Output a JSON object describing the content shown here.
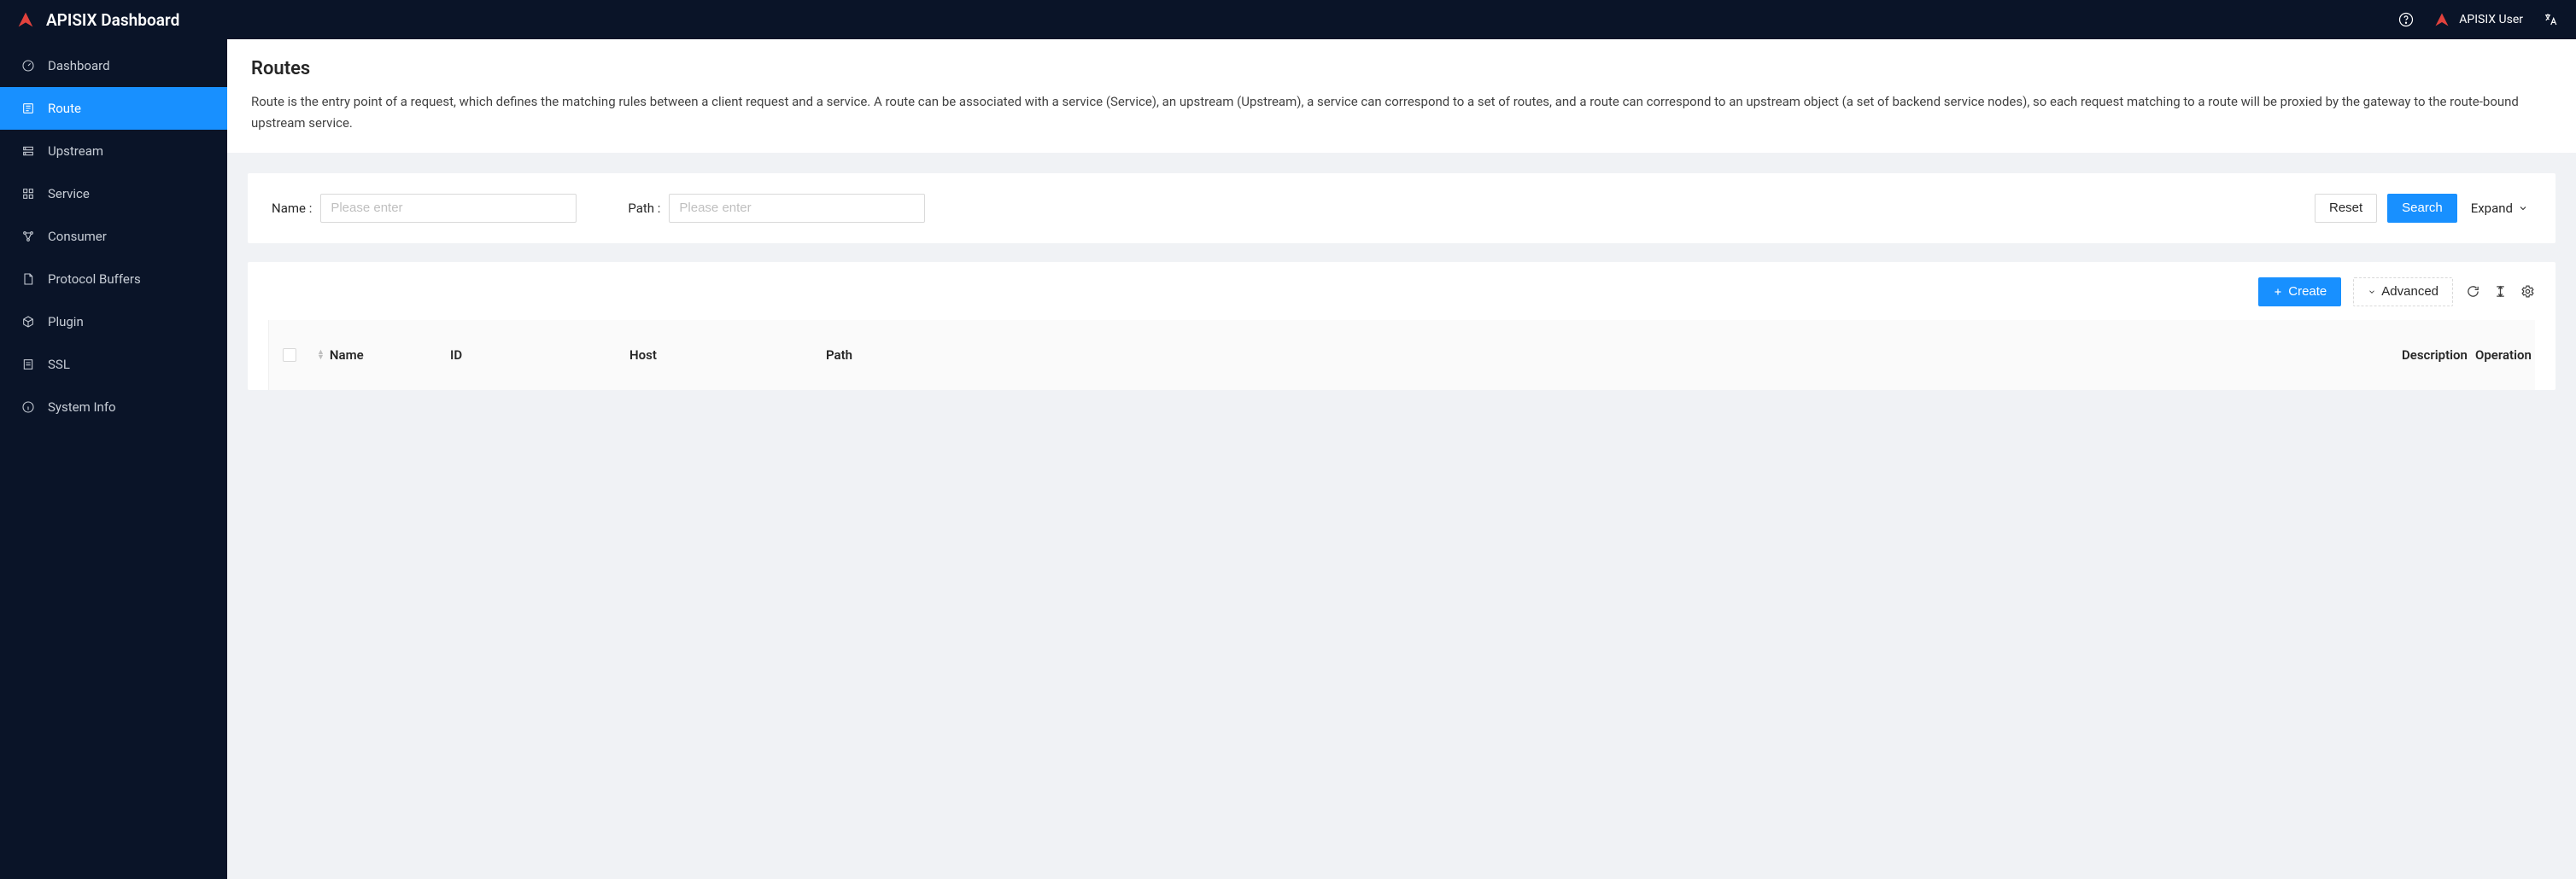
{
  "header": {
    "app_name": "APISIX Dashboard",
    "user_name": "APISIX User"
  },
  "sidebar": {
    "items": [
      {
        "label": "Dashboard",
        "icon": "gauge-icon",
        "key": "dashboard"
      },
      {
        "label": "Route",
        "icon": "route-icon",
        "key": "route"
      },
      {
        "label": "Upstream",
        "icon": "server-icon",
        "key": "upstream"
      },
      {
        "label": "Service",
        "icon": "grid-icon",
        "key": "service"
      },
      {
        "label": "Consumer",
        "icon": "nodes-icon",
        "key": "consumer"
      },
      {
        "label": "Protocol Buffers",
        "icon": "file-icon",
        "key": "protobuf"
      },
      {
        "label": "Plugin",
        "icon": "cube-icon",
        "key": "plugin"
      },
      {
        "label": "SSL",
        "icon": "cert-icon",
        "key": "ssl"
      },
      {
        "label": "System Info",
        "icon": "info-icon",
        "key": "sysinfo"
      }
    ],
    "selected_key": "route"
  },
  "page": {
    "title": "Routes",
    "description": "Route is the entry point of a request, which defines the matching rules between a client request and a service. A route can be associated with a service (Service), an upstream (Upstream), a service can correspond to a set of routes, and a route can correspond to an upstream object (a set of backend service nodes), so each request matching to a route will be proxied by the gateway to the route-bound upstream service."
  },
  "search": {
    "name_label": "Name :",
    "name_placeholder": "Please enter",
    "name_value": "",
    "path_label": "Path :",
    "path_placeholder": "Please enter",
    "path_value": "",
    "reset_label": "Reset",
    "search_label": "Search",
    "expand_label": "Expand"
  },
  "toolbar": {
    "create_label": "Create",
    "advanced_label": "Advanced"
  },
  "table": {
    "columns": {
      "name": "Name",
      "id": "ID",
      "host": "Host",
      "path": "Path",
      "description": "Description",
      "operation": "Operation"
    },
    "rows": []
  }
}
